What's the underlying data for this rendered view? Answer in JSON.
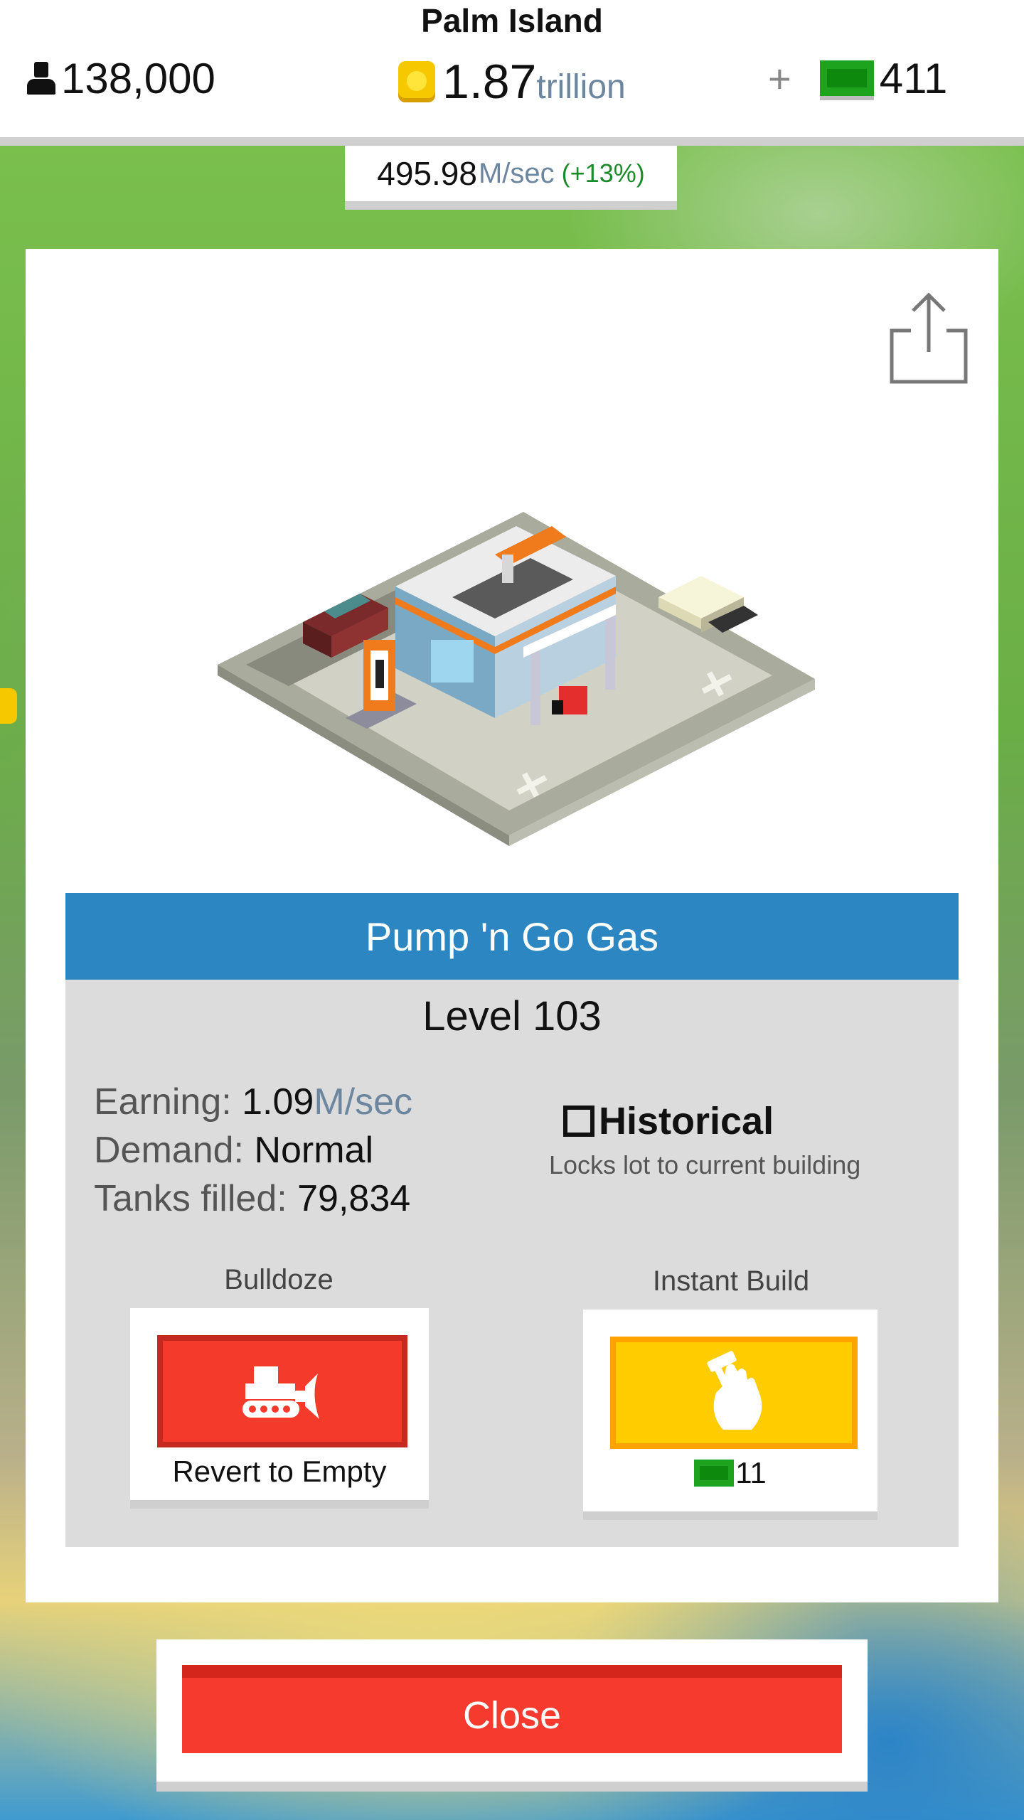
{
  "header": {
    "city_name": "Palm Island",
    "population": "138,000",
    "money_value": "1.87",
    "money_unit": "trillion",
    "cash_plus": "+",
    "cash_value": "411",
    "rate_value": "495.98",
    "rate_unit": "M/sec",
    "rate_bonus": "(+13%)"
  },
  "building": {
    "name": "Pump 'n Go Gas",
    "level": "Level 103",
    "stats": {
      "earning_label": "Earning: ",
      "earning_value": "1.09",
      "earning_unit": "M/sec",
      "demand_label": "Demand: ",
      "demand_value": "Normal",
      "tanks_label": "Tanks filled: ",
      "tanks_value": "79,834"
    },
    "historical": {
      "label": "Historical",
      "description": "Locks lot to current building",
      "checked": false
    }
  },
  "actions": {
    "bulldoze_title": "Bulldoze",
    "bulldoze_caption": "Revert to Empty",
    "instant_title": "Instant Build",
    "instant_cost": "11"
  },
  "close_label": "Close",
  "icons": {
    "population": "person-icon",
    "money": "coin-icon",
    "cash": "cash-icon",
    "share": "share-icon",
    "bulldoze": "bulldozer-icon",
    "instant": "hammer-hand-icon"
  },
  "colors": {
    "header_blue": "#2b86c2",
    "bulldoze_red": "#f43a2a",
    "instant_yellow": "#ffcc00",
    "close_red": "#f63b2e",
    "cash_green": "#1ea31e",
    "coin_gold": "#f6c800",
    "bonus_green": "#1b8a2a"
  }
}
